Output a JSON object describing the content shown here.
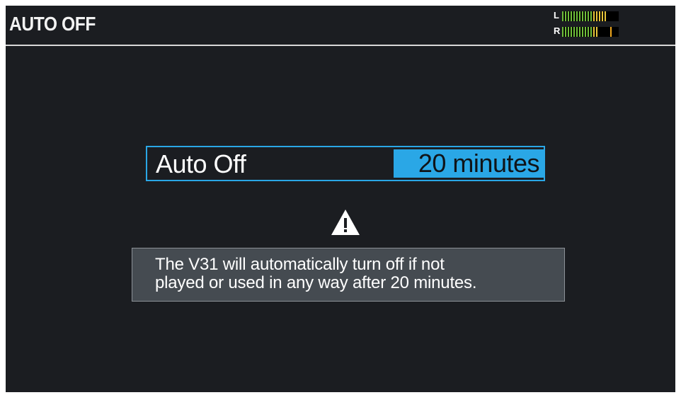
{
  "header": {
    "title": "AUTO OFF"
  },
  "level_meter": {
    "left_label": "L",
    "right_label": "R",
    "left_level": 0.78,
    "right_level": 0.66,
    "left_peak": 0.78,
    "right_peak": 0.9,
    "colors": {
      "low": "#6fbf3a",
      "mid": "#e8c53a",
      "peak": "#f0a81f",
      "track": "#000000"
    }
  },
  "setting": {
    "label": "Auto Off",
    "value": "20 minutes"
  },
  "warning": {
    "icon": "warning-triangle-icon",
    "line1": "The V31 will automatically turn off if not",
    "line2": "played or used in any way after 20 minutes."
  },
  "colors": {
    "background": "#1b1d21",
    "accent": "#2aa7e6",
    "message_box": "#454b51"
  }
}
